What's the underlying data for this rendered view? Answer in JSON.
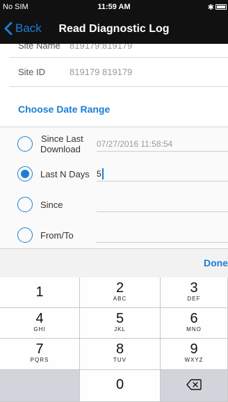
{
  "status_bar": {
    "carrier": "No SIM",
    "time": "11:59 AM",
    "bluetooth": "✱"
  },
  "nav": {
    "back_label": "Back",
    "title": "Read Diagnostic Log"
  },
  "site": {
    "name_label": "Site Name",
    "name_value": "819179:819179",
    "id_label": "Site ID",
    "id_value": "819179 819179"
  },
  "section_title": "Choose Date Range",
  "options": [
    {
      "label_line1": "Since Last",
      "label_line2": "Download",
      "value": "07/27/2016 11:58:54",
      "selected": false
    },
    {
      "label_line1": "Last N Days",
      "label_line2": "",
      "value": "5",
      "selected": true
    },
    {
      "label_line1": "Since",
      "label_line2": "",
      "value": "",
      "selected": false
    },
    {
      "label_line1": "From/To",
      "label_line2": "",
      "value": "",
      "selected": false
    }
  ],
  "done_label": "Done",
  "keypad": {
    "k1": {
      "digit": "1",
      "letters": ""
    },
    "k2": {
      "digit": "2",
      "letters": "ABC"
    },
    "k3": {
      "digit": "3",
      "letters": "DEF"
    },
    "k4": {
      "digit": "4",
      "letters": "GHI"
    },
    "k5": {
      "digit": "5",
      "letters": "JKL"
    },
    "k6": {
      "digit": "6",
      "letters": "MNO"
    },
    "k7": {
      "digit": "7",
      "letters": "PQRS"
    },
    "k8": {
      "digit": "8",
      "letters": "TUV"
    },
    "k9": {
      "digit": "9",
      "letters": "WXYZ"
    },
    "k0": {
      "digit": "0",
      "letters": ""
    }
  },
  "colors": {
    "accent": "#1a7fd4",
    "nav_background": "#111111",
    "keypad_background": "#d1d5db"
  }
}
